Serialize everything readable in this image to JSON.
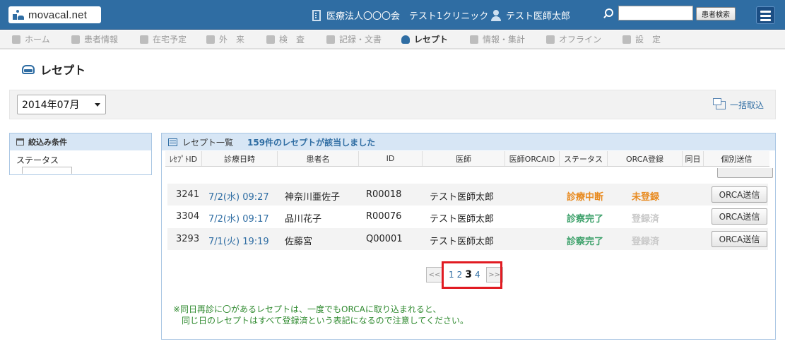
{
  "header": {
    "logo_text": "movacal.net",
    "clinic": "医療法人〇〇〇会　テスト1クリニック",
    "doctor": "テスト医師太郎",
    "search_placeholder": "",
    "search_button": "患者検索",
    "colors": {
      "bar": "#2f6da3",
      "accent": "#2f6da3"
    }
  },
  "nav": {
    "items": [
      {
        "label": "ホーム",
        "icon": "home-icon"
      },
      {
        "label": "患者情報",
        "icon": "people-icon"
      },
      {
        "label": "在宅予定",
        "icon": "clock-icon"
      },
      {
        "label": "外　来",
        "icon": "clinic-icon"
      },
      {
        "label": "検　査",
        "icon": "chart-icon"
      },
      {
        "label": "記録・文書",
        "icon": "document-icon"
      },
      {
        "label": "レセプト",
        "icon": "tray-icon",
        "active": true
      },
      {
        "label": "情報・集計",
        "icon": "monitor-icon"
      },
      {
        "label": "オフライン",
        "icon": "plane-icon"
      },
      {
        "label": "設　定",
        "icon": "wrench-icon"
      }
    ]
  },
  "page": {
    "title": "レセプト",
    "month": "2014年07月",
    "bulk_import": "一括取込"
  },
  "filter": {
    "title": "絞込み条件",
    "status_label": "ステータス"
  },
  "list": {
    "title": "レセプト一覧",
    "count_text": "159件のレセプトが該当しました",
    "columns": [
      "ﾚｾﾌﾟﾄID",
      "診療日時",
      "患者名",
      "ID",
      "医師",
      "医師ORCAID",
      "ステータス",
      "ORCA登録",
      "同日",
      "個別送信"
    ],
    "rows": [
      {
        "rid": "3241",
        "date": "7/2(水) 09:27",
        "name": "神奈川亜佐子",
        "pid": "R00018",
        "doctor": "テスト医師太郎",
        "status": "診療中断",
        "orca": "未登録",
        "send": "ORCA送信"
      },
      {
        "rid": "3304",
        "date": "7/2(水) 09:17",
        "name": "品川花子",
        "pid": "R00076",
        "doctor": "テスト医師太郎",
        "status": "診察完了",
        "orca": "登録済",
        "send": "ORCA送信"
      },
      {
        "rid": "3293",
        "date": "7/1(火) 19:19",
        "name": "佐藤宮",
        "pid": "Q00001",
        "doctor": "テスト医師太郎",
        "status": "診察完了",
        "orca": "登録済",
        "send": "ORCA送信"
      }
    ]
  },
  "pager": {
    "prev": "<<",
    "next": ">>",
    "pages": [
      "1",
      "2",
      "3",
      "4"
    ],
    "current": "3"
  },
  "note": {
    "line1": "※同日再診に〇があるレセプトは、一度でもORCAに取り込まれると、",
    "line2": "同じ日のレセプトはすべて登録済という表記になるので注意してください。"
  }
}
